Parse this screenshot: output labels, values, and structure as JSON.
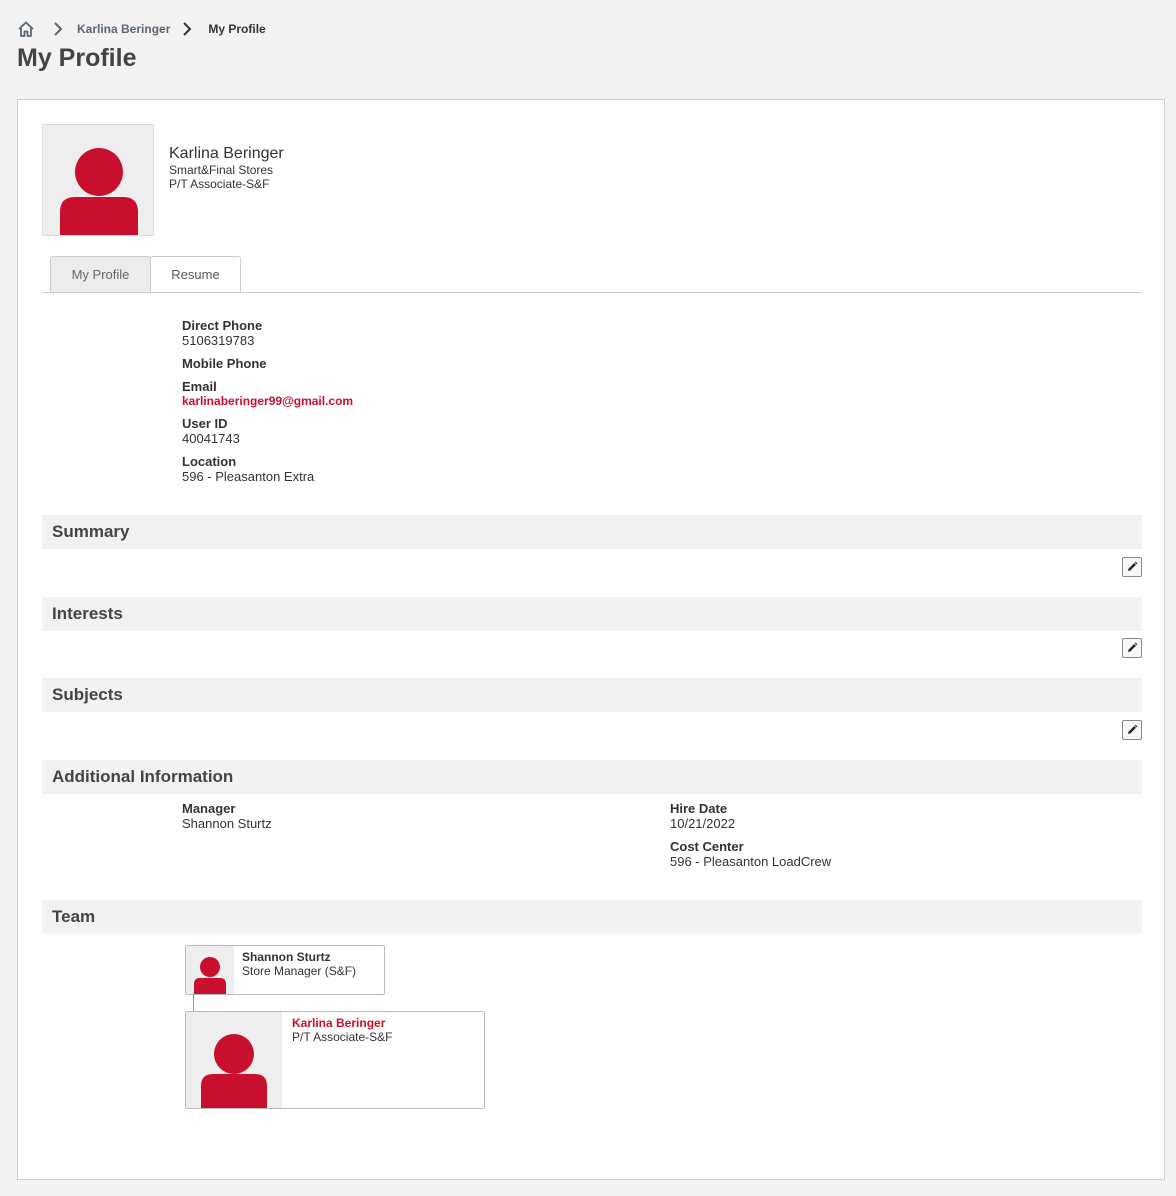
{
  "breadcrumb": {
    "parent": "Karlina Beringer",
    "current": "My Profile"
  },
  "page_title": "My Profile",
  "profile": {
    "name": "Karlina Beringer",
    "company": "Smart&Final Stores",
    "job_title": "P/T Associate-S&F"
  },
  "tabs": [
    {
      "label": "My Profile",
      "active": true
    },
    {
      "label": "Resume",
      "active": false
    }
  ],
  "contact": {
    "direct_phone_label": "Direct Phone",
    "direct_phone": "5106319783",
    "mobile_phone_label": "Mobile Phone",
    "email_label": "Email",
    "email": "karlinaberinger99@gmail.com",
    "user_id_label": "User ID",
    "user_id": "40041743",
    "location_label": "Location",
    "location": "596 - Pleasanton Extra"
  },
  "sections": {
    "summary": "Summary",
    "interests": "Interests",
    "subjects": "Subjects",
    "additional": "Additional Information",
    "team": "Team"
  },
  "additional": {
    "manager_label": "Manager",
    "manager": "Shannon Sturtz",
    "hire_date_label": "Hire Date",
    "hire_date": "10/21/2022",
    "cost_center_label": "Cost Center",
    "cost_center": "596 - Pleasanton LoadCrew"
  },
  "team": {
    "manager": {
      "name": "Shannon Sturtz",
      "title": "Store Manager (S&F)"
    },
    "self": {
      "name": "Karlina Beringer",
      "title": "P/T Associate-S&F"
    }
  },
  "colors": {
    "accent": "#c8102e",
    "page_bg": "#f3f3f3",
    "section_bg": "#f2f2f2"
  },
  "icons": {
    "home": "home-icon",
    "separator": "chevron-right-icon",
    "edit": "pencil-icon",
    "avatar": "person-silhouette-icon"
  }
}
